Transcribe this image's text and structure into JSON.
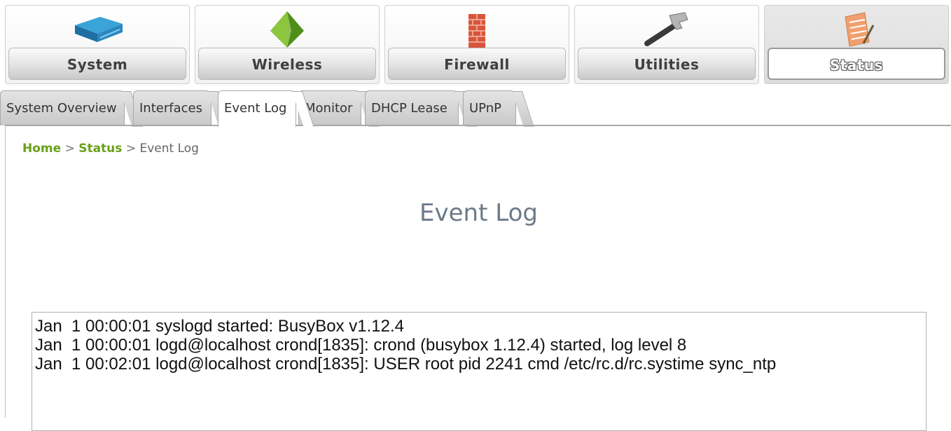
{
  "nav": {
    "items": [
      {
        "label": "System",
        "icon": "router-icon"
      },
      {
        "label": "Wireless",
        "icon": "pyramid-icon"
      },
      {
        "label": "Firewall",
        "icon": "brick-wall-icon"
      },
      {
        "label": "Utilities",
        "icon": "hammer-icon"
      },
      {
        "label": "Status",
        "icon": "notepad-icon"
      }
    ],
    "active": "Status"
  },
  "tabs": {
    "items": [
      "System Overview",
      "Interfaces",
      "Event Log",
      "Monitor",
      "DHCP Lease",
      "UPnP"
    ],
    "active": "Event Log"
  },
  "breadcrumb": {
    "home": "Home",
    "sep1": ">",
    "status": "Status",
    "sep2": ">",
    "current": "Event Log"
  },
  "page": {
    "title": "Event Log"
  },
  "log": {
    "lines": [
      "Jan  1 00:00:01 syslogd started: BusyBox v1.12.4",
      "Jan  1 00:00:01 logd@localhost crond[1835]: crond (busybox 1.12.4) started, log level 8",
      "Jan  1 00:02:01 logd@localhost crond[1835]: USER root pid 2241 cmd /etc/rc.d/rc.systime sync_ntp"
    ]
  },
  "colors": {
    "link_green": "#6aa118",
    "title_gray": "#6c7a88"
  }
}
